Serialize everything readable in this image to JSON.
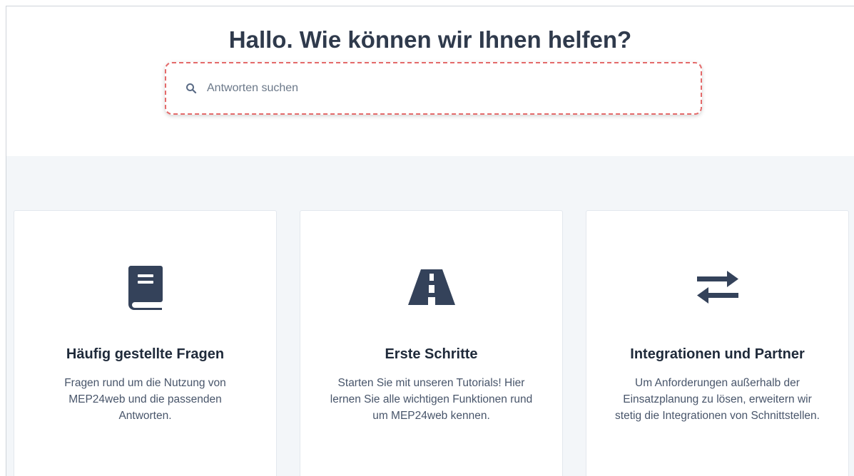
{
  "hero": {
    "title": "Hallo. Wie können wir Ihnen helfen?"
  },
  "search": {
    "placeholder": "Antworten suchen",
    "icon": "search-icon"
  },
  "colors": {
    "text_dark": "#2f3a4c",
    "icon_dark": "#34425a",
    "content_bg": "#f3f6f9",
    "highlight_border": "#e46a6a"
  },
  "cards": [
    {
      "icon": "book-icon",
      "title": "Häufig gestellte Fragen",
      "desc_lines": [
        "Fragen rund um die Nutzung von",
        "MEP24web und die passenden",
        "Antworten."
      ]
    },
    {
      "icon": "road-icon",
      "title": "Erste Schritte",
      "desc_lines": [
        "Starten Sie mit unseren Tutorials! Hier",
        "lernen Sie alle wichtigen Funktionen rund",
        "um MEP24web kennen."
      ]
    },
    {
      "icon": "exchange-arrows-icon",
      "title": "Integrationen und Partner",
      "desc_lines": [
        "Um Anforderungen außerhalb der",
        "Einsatzplanung zu lösen, erweitern wir",
        "stetig die Integrationen von Schnittstellen."
      ]
    }
  ]
}
